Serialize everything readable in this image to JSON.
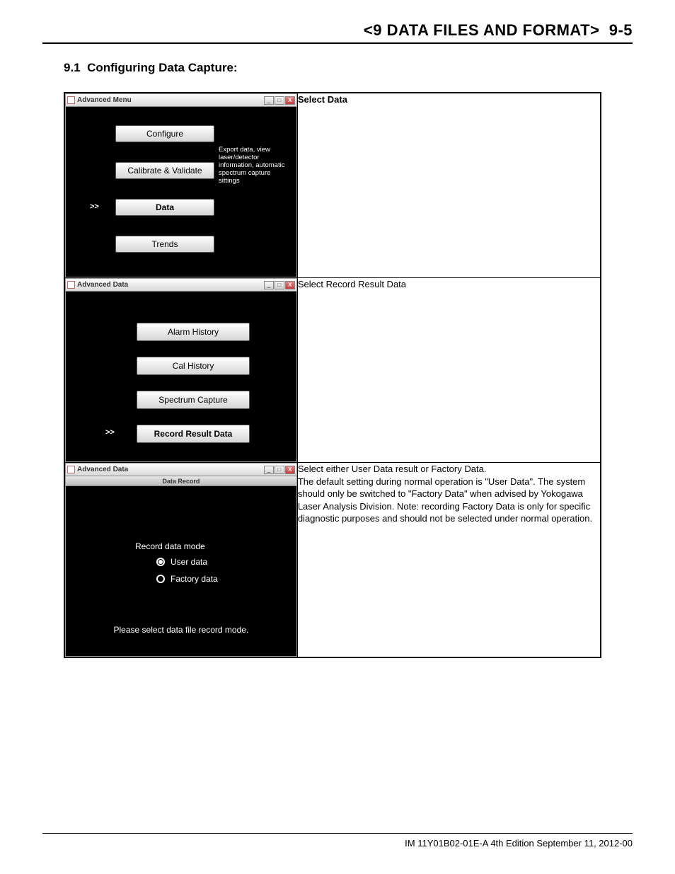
{
  "header": {
    "chapter": "<9 DATA FILES AND FORMAT>",
    "page": "9-5"
  },
  "section": {
    "number": "9.1",
    "title": "Configuring Data Capture:"
  },
  "row1": {
    "windowTitle": "Advanced Menu",
    "buttons": {
      "configure": "Configure",
      "calValidate": "Calibrate & Validate",
      "data": "Data",
      "trends": "Trends"
    },
    "pointer": ">>",
    "helper": "Export data, view laser/detector information, automatic spectrum capture sittings",
    "desc": "Select Data"
  },
  "row2": {
    "windowTitle": "Advanced Data",
    "buttons": {
      "alarm": "Alarm History",
      "cal": "Cal History",
      "spectrum": "Spectrum Capture",
      "record": "Record Result Data"
    },
    "pointer": ">>",
    "desc": "Select Record Result Data"
  },
  "row3": {
    "windowTitle": "Advanced Data",
    "subtitle": "Data Record",
    "modeLabel": "Record data mode",
    "options": {
      "user": "User data",
      "factory": "Factory data"
    },
    "prompt": "Please select data file record mode.",
    "desc": "Select either User Data result or Factory Data.\nThe default setting during normal operation is \"User Data\". The system should only be switched to \"Factory Data\" when advised by Yokogawa Laser Analysis Division. Note: recording Factory Data is only for specific diagnostic purposes and should not be selected under normal operation."
  },
  "footer": "IM 11Y01B02-01E-A  4th Edition September 11, 2012-00"
}
